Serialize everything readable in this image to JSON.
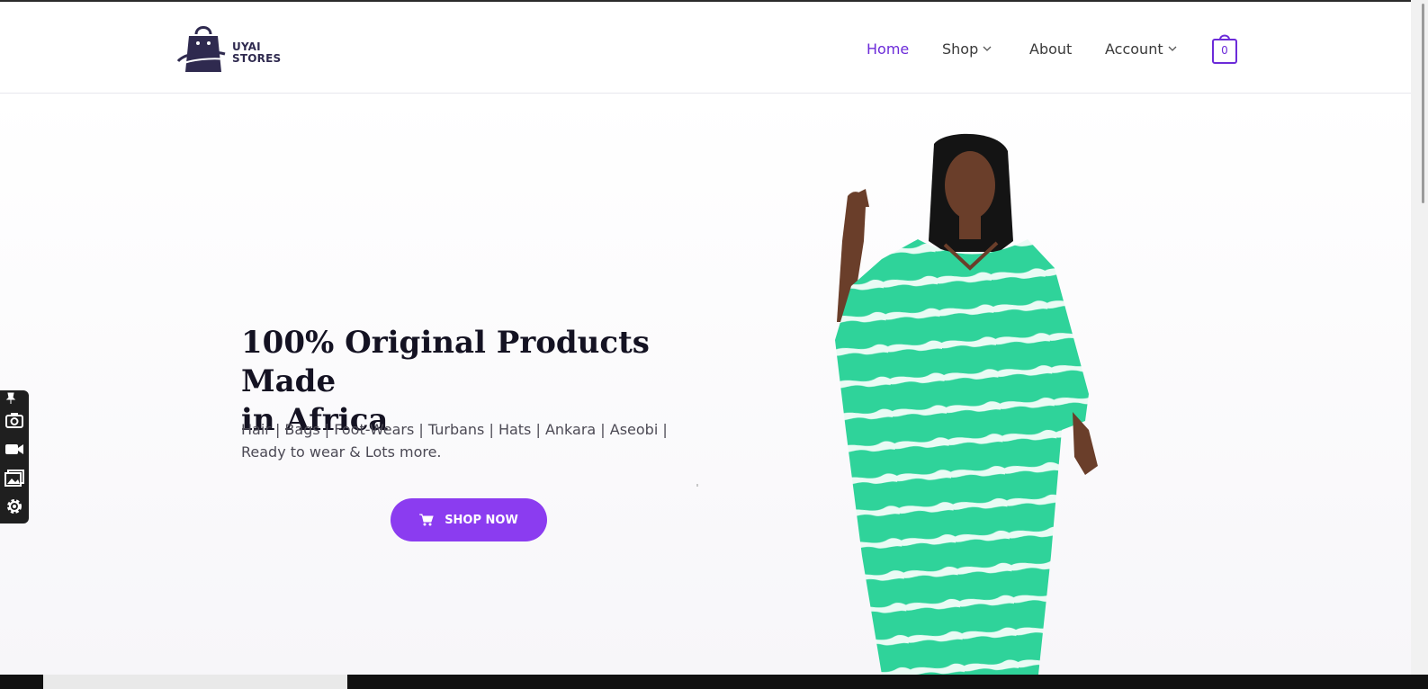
{
  "brand": {
    "line1": "UYAI",
    "line2": "STORES",
    "icon": "shopping-bag-logo"
  },
  "nav": {
    "home": "Home",
    "shop": "Shop",
    "about": "About",
    "account": "Account"
  },
  "cart": {
    "count": "0",
    "icon": "bag-icon"
  },
  "hero": {
    "headline_line1": "100% Original Products Made",
    "headline_line2": "in Africa",
    "subtext_line1": "Hair | Bags | Foot-Wears | Turbans | Hats | Ankara | Aseobi |",
    "subtext_line2": "Ready to wear & Lots more.",
    "button_label": "SHOP NOW",
    "button_icon": "cart-icon"
  },
  "colors": {
    "accent": "#6c2bd9",
    "button": "#8b3cf0",
    "headline": "#141222",
    "dress": "#2fd39a"
  },
  "side_tools": [
    "pin-icon",
    "camera-icon",
    "video-icon",
    "gallery-icon",
    "gear-icon"
  ]
}
